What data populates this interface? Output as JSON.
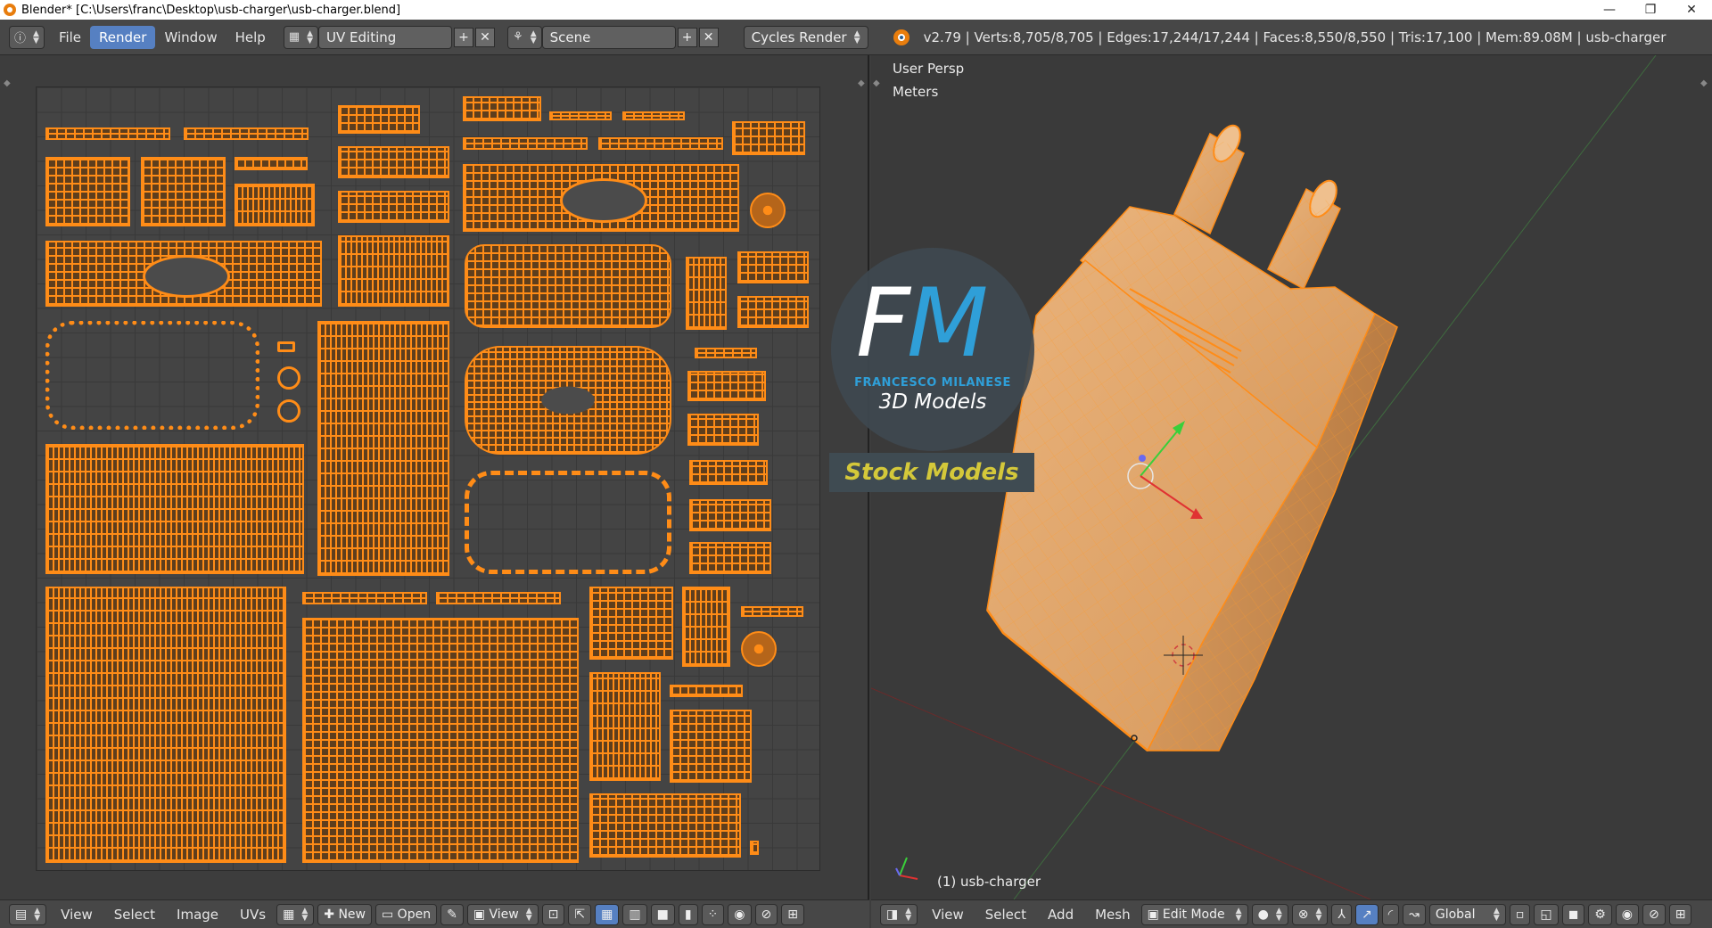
{
  "window": {
    "title": "Blender* [C:\\Users\\franc\\Desktop\\usb-charger\\usb-charger.blend]",
    "minimize": "—",
    "maximize": "❐",
    "close": "✕"
  },
  "topbar": {
    "info_icon": "ⓘ",
    "menus": [
      "File",
      "Render",
      "Window",
      "Help"
    ],
    "active_menu": "Render",
    "screen_layout": "UV Editing",
    "scene": "Scene",
    "render_engine": "Cycles Render",
    "stats": "v2.79 | Verts:8,705/8,705 | Edges:17,244/17,244 | Faces:8,550/8,550 | Tris:17,100 | Mem:89.08M | usb-charger"
  },
  "viewport": {
    "view_label": "User Persp",
    "units_label": "Meters",
    "object_label": "(1) usb-charger",
    "mesh_color": "#e8a860",
    "wire_color": "#ff8c17"
  },
  "watermark": {
    "letter_f": "F",
    "letter_m": "M",
    "name": "FRANCESCO MILANESE",
    "subtitle": "3D Models",
    "banner": "Stock Models"
  },
  "uv_bottom": {
    "items": [
      "View",
      "Select",
      "Image",
      "UVs"
    ],
    "new_label": "New",
    "open_label": "Open",
    "view_label": "View"
  },
  "vp_bottom": {
    "items": [
      "View",
      "Select",
      "Add",
      "Mesh"
    ],
    "mode": "Edit Mode",
    "orientation": "Global"
  }
}
